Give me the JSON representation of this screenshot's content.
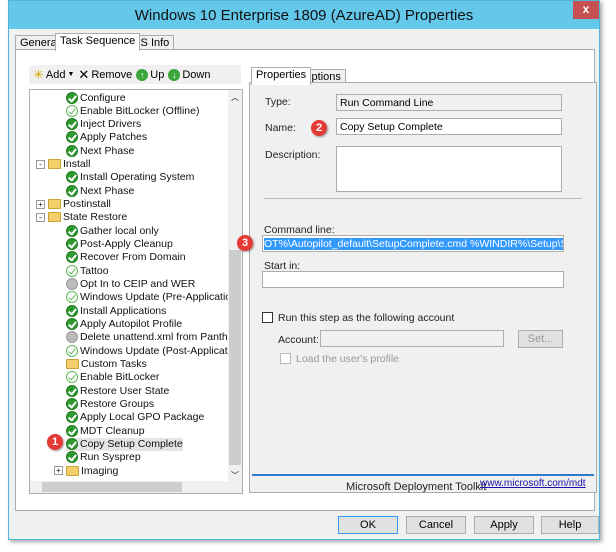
{
  "window": {
    "title": "Windows 10 Enterprise 1809 (AzureAD) Properties",
    "close": "x"
  },
  "tabs": [
    "General",
    "Task Sequence",
    "OS Info"
  ],
  "toolbar": {
    "add": "Add",
    "remove": "Remove",
    "up": "Up",
    "down": "Down"
  },
  "tree": [
    {
      "label": "Configure",
      "icon": "g",
      "lvl": 2
    },
    {
      "label": "Enable BitLocker (Offline)",
      "icon": "l",
      "lvl": 2
    },
    {
      "label": "Inject Drivers",
      "icon": "g",
      "lvl": 2
    },
    {
      "label": "Apply Patches",
      "icon": "g",
      "lvl": 2
    },
    {
      "label": "Next Phase",
      "icon": "g",
      "lvl": 2
    },
    {
      "label": "Install",
      "icon": "f",
      "lvl": 1,
      "toggle": "-"
    },
    {
      "label": "Install Operating System",
      "icon": "g",
      "lvl": 2
    },
    {
      "label": "Next Phase",
      "icon": "g",
      "lvl": 2
    },
    {
      "label": "Postinstall",
      "icon": "f",
      "lvl": 1,
      "toggle": "+"
    },
    {
      "label": "State Restore",
      "icon": "f",
      "lvl": 1,
      "toggle": "-"
    },
    {
      "label": "Gather local only",
      "icon": "g",
      "lvl": 2
    },
    {
      "label": "Post-Apply Cleanup",
      "icon": "g",
      "lvl": 2
    },
    {
      "label": "Recover From Domain",
      "icon": "g",
      "lvl": 2
    },
    {
      "label": "Tattoo",
      "icon": "l",
      "lvl": 2
    },
    {
      "label": "Opt In to CEIP and WER",
      "icon": "x",
      "lvl": 2
    },
    {
      "label": "Windows Update (Pre-Application Inst",
      "icon": "l",
      "lvl": 2
    },
    {
      "label": "Install Applications",
      "icon": "g",
      "lvl": 2
    },
    {
      "label": "Apply Autopilot Profile",
      "icon": "g",
      "lvl": 2
    },
    {
      "label": "Delete unattend.xml from Panther",
      "icon": "x",
      "lvl": 2
    },
    {
      "label": "Windows Update (Post-Application Ins",
      "icon": "l",
      "lvl": 2
    },
    {
      "label": "Custom Tasks",
      "icon": "f",
      "lvl": 2
    },
    {
      "label": "Enable BitLocker",
      "icon": "l",
      "lvl": 2
    },
    {
      "label": "Restore User State",
      "icon": "g",
      "lvl": 2
    },
    {
      "label": "Restore Groups",
      "icon": "g",
      "lvl": 2
    },
    {
      "label": "Apply Local GPO Package",
      "icon": "g",
      "lvl": 2
    },
    {
      "label": "MDT Cleanup",
      "icon": "g",
      "lvl": 2
    },
    {
      "label": "Copy Setup Complete",
      "icon": "g",
      "lvl": 2,
      "selected": true
    },
    {
      "label": "Run Sysprep",
      "icon": "g",
      "lvl": 2
    },
    {
      "label": "Imaging",
      "icon": "f",
      "lvl": 2,
      "toggle": "+"
    }
  ],
  "right_tabs": [
    "Properties",
    "Options"
  ],
  "props": {
    "type_label": "Type:",
    "type_value": "Run Command Line",
    "name_label": "Name:",
    "name_value": "Copy Setup Complete",
    "desc_label": "Description:",
    "desc_value": "",
    "cmd_label": "Command line:",
    "cmd_value": "OT%\\Autopilot_default\\SetupComplete.cmd %WINDIR%\\Setup\\Scripts\\ /c",
    "startin_label": "Start in:",
    "startin_value": "",
    "runas_label": "Run this step as the following account",
    "account_label": "Account:",
    "account_value": "",
    "set_button": "Set...",
    "load_profile_label": "Load the user's profile"
  },
  "footer": {
    "brand": "Microsoft Deployment Toolkit",
    "link": "www.microsoft.com/mdt"
  },
  "buttons": {
    "ok": "OK",
    "cancel": "Cancel",
    "apply": "Apply",
    "help": "Help"
  },
  "badges": [
    "1",
    "2",
    "3"
  ],
  "colors": {
    "titlebar": "#63c8ea",
    "accent": "#3399ff",
    "badge": "#e53935"
  }
}
